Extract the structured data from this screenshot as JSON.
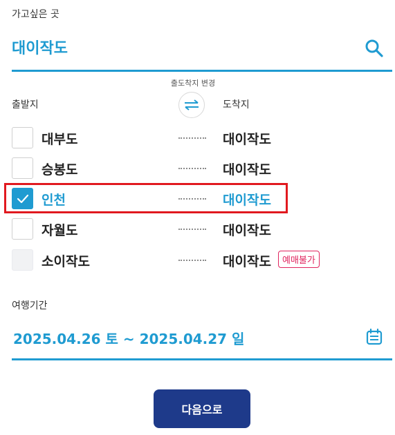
{
  "destination": {
    "label": "가고싶은 곳",
    "value": "대이작도"
  },
  "swap": {
    "caption": "출도착지 변경",
    "icon": "swap-arrows-icon"
  },
  "columns": {
    "departure": "출발지",
    "arrival": "도착지"
  },
  "routes": [
    {
      "from": "대부도",
      "to": "대이작도",
      "checked": false,
      "available": true
    },
    {
      "from": "승봉도",
      "to": "대이작도",
      "checked": false,
      "available": true
    },
    {
      "from": "인천",
      "to": "대이작도",
      "checked": true,
      "available": true
    },
    {
      "from": "자월도",
      "to": "대이작도",
      "checked": false,
      "available": true
    },
    {
      "from": "소이작도",
      "to": "대이작도",
      "checked": false,
      "available": false,
      "badge": "예매불가"
    }
  ],
  "period": {
    "label": "여행기간",
    "value": "2025.04.26 토 ~ 2025.04.27 일"
  },
  "next_button": "다음으로",
  "colors": {
    "accent": "#1f9bd1",
    "button": "#1e3a8a",
    "badge": "#e0245e",
    "highlight": "#e1191f"
  }
}
